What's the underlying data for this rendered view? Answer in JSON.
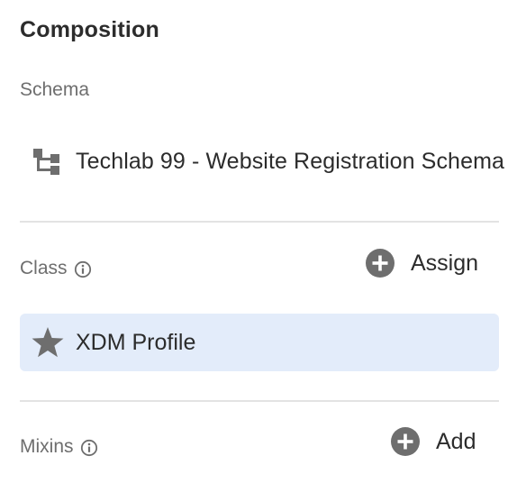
{
  "composition": {
    "title": "Composition",
    "schema": {
      "label": "Schema",
      "name": "Techlab 99 - Website Registration Schema",
      "icon": "schema-tree-icon"
    },
    "class": {
      "label": "Class",
      "info_icon": "info-icon",
      "action_label": "Assign",
      "action_icon": "add-circle-icon",
      "assigned": {
        "name": "XDM Profile",
        "icon": "star-icon",
        "highlight_color": "#e3ecfa"
      }
    },
    "mixins": {
      "label": "Mixins",
      "info_icon": "info-icon",
      "action_label": "Add",
      "action_icon": "add-circle-icon"
    }
  }
}
